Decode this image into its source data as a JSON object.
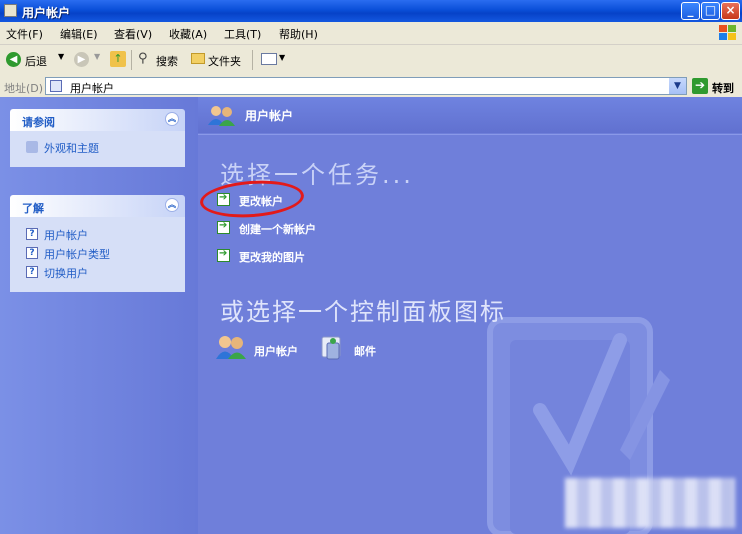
{
  "window": {
    "title": "用户帐户"
  },
  "menu": [
    "文件(F)",
    "编辑(E)",
    "查看(V)",
    "收藏(A)",
    "工具(T)",
    "帮助(H)"
  ],
  "toolbar": {
    "back": "后退",
    "search": "搜索",
    "folders": "文件夹"
  },
  "address": {
    "label": "地址(D)",
    "value": "用户帐户",
    "go": "转到"
  },
  "sidebar": {
    "see_also": {
      "title": "请参阅",
      "items": [
        "外观和主题"
      ]
    },
    "learn": {
      "title": "了解",
      "items": [
        "用户帐户",
        "用户帐户类型",
        "切换用户"
      ]
    }
  },
  "main": {
    "header": "用户帐户",
    "task_heading": "选择一个任务...",
    "tasks": [
      "更改帐户",
      "创建一个新帐户",
      "更改我的图片"
    ],
    "panel_heading": "或选择一个控制面板图标",
    "icons": [
      "用户帐户",
      "邮件"
    ]
  },
  "colors": {
    "highlight": "#e21a1a",
    "panel_bg": "#6f7fda",
    "link": "#215dc6"
  }
}
